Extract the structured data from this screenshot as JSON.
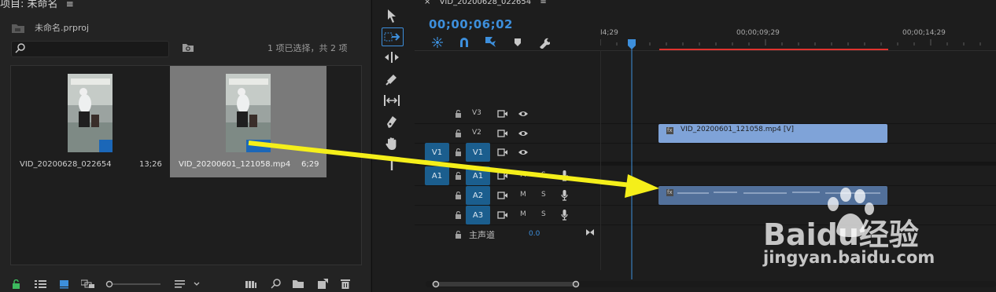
{
  "project": {
    "title": "项目: 未命名",
    "menu_icon": "hamburger-icon",
    "file_name": "未命名.prproj",
    "selection_info": "1 项已选择，共 2 项",
    "clips": [
      {
        "name": "VID_20200628_022654",
        "duration": "13;26",
        "selected": false
      },
      {
        "name": "VID_20200601_121058.mp4",
        "duration": "6;29",
        "selected": true
      }
    ]
  },
  "timeline": {
    "tab_close": "×",
    "tab_label": "VID_20200628_022654",
    "timecode": "00;00;06;02",
    "ruler_labels": [
      "I4;29",
      "00;00;09;29",
      "00;00;14;29"
    ],
    "tracks": {
      "v3": "V3",
      "v2": "V2",
      "v1_src": "V1",
      "v1": "V1",
      "a1_src": "A1",
      "a1": "A1",
      "a2": "A2",
      "a3": "A3",
      "m": "M",
      "s": "S",
      "master": "主声道",
      "master_value": "0.0"
    },
    "video_clip_label": "VID_20200601_121058.mp4 [V]",
    "fx_badge": "fx"
  },
  "watermark": {
    "brand": "Baidu经验",
    "url": "jingyan.baidu.com"
  },
  "colors": {
    "accent_blue": "#3d8fdc",
    "track_patch": "#1b5e8e",
    "video_clip": "#7fa3d8",
    "audio_clip": "#52709a",
    "work_area": "#e0332e",
    "annotation_arrow": "#f5ef1a"
  }
}
